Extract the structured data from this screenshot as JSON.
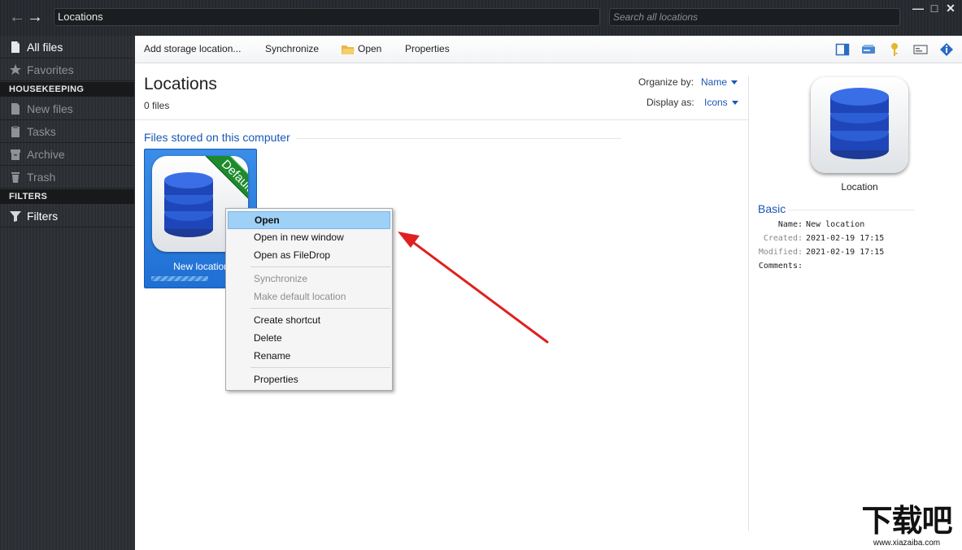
{
  "window": {
    "address": "Locations",
    "search_placeholder": "Search all locations",
    "controls": {
      "minimize": "—",
      "maximize": "□",
      "close": "✕"
    },
    "nav": {
      "back": "←",
      "forward": "→"
    }
  },
  "sidebar": {
    "all_files": "All files",
    "favorites": "Favorites",
    "housekeeping_header": "HOUSEKEEPING",
    "new_files": "New files",
    "tasks": "Tasks",
    "archive": "Archive",
    "trash": "Trash",
    "filters_header": "FILTERS",
    "filters": "Filters"
  },
  "toolbar": {
    "add_storage": "Add storage location...",
    "synchronize": "Synchronize",
    "open": "Open",
    "properties": "Properties"
  },
  "content": {
    "title": "Locations",
    "file_count": "0 files",
    "organize_label": "Organize by:",
    "organize_value": "Name",
    "display_label": "Display as:",
    "display_value": "Icons",
    "group_title": "Files stored on this computer",
    "tile": {
      "label": "New location",
      "ribbon": "Default"
    }
  },
  "context_menu": {
    "items": [
      {
        "label": "Open",
        "state": "highlighted"
      },
      {
        "label": "Open in new window",
        "state": "normal"
      },
      {
        "label": "Open as FileDrop",
        "state": "normal"
      },
      {
        "label": "Synchronize",
        "state": "disabled"
      },
      {
        "label": "Make default location",
        "state": "disabled"
      },
      {
        "label": "Create shortcut",
        "state": "normal"
      },
      {
        "label": "Delete",
        "state": "normal"
      },
      {
        "label": "Rename",
        "state": "normal"
      },
      {
        "label": "Properties",
        "state": "normal"
      }
    ]
  },
  "details": {
    "icon_label": "Location",
    "section_title": "Basic",
    "name_key": "Name:",
    "name_value": "New location",
    "created_key": "Created:",
    "created_value": "2021-02-19 17:15",
    "modified_key": "Modified:",
    "modified_value": "2021-02-19 17:15",
    "comments_key": "Comments:",
    "comments_value": ""
  },
  "watermark": {
    "big": "下载吧",
    "small": "www.xiazaiba.com"
  },
  "colors": {
    "accent": "#1a57b7",
    "highlight": "#9fd0f6",
    "arrow": "#e02020",
    "ribbon": "#1d8a2c"
  }
}
